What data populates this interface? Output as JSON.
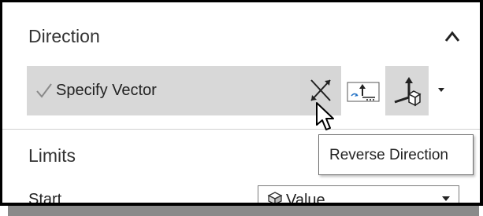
{
  "direction": {
    "title": "Direction",
    "collapse_icon": "chevron-up-icon",
    "specify_vector_label": "Specify Vector",
    "check_icon": "check-icon",
    "buttons": [
      {
        "name": "reverse-direction",
        "icon": "reverse-direction-icon"
      },
      {
        "name": "inferred-vector",
        "icon": "inferred-vector-icon"
      },
      {
        "name": "vector-3d",
        "icon": "vector-3d-icon"
      },
      {
        "name": "vector-options-dropdown",
        "icon": "chevron-down-icon"
      }
    ]
  },
  "limits": {
    "title": "Limits",
    "start_label": "Start",
    "start_value": "Value",
    "start_value_icon": "cube-icon"
  },
  "tooltip": {
    "text": "Reverse Direction"
  },
  "colors": {
    "row_highlight": "#d8d8d8",
    "text": "#222222",
    "check": "#8a8a8a"
  }
}
